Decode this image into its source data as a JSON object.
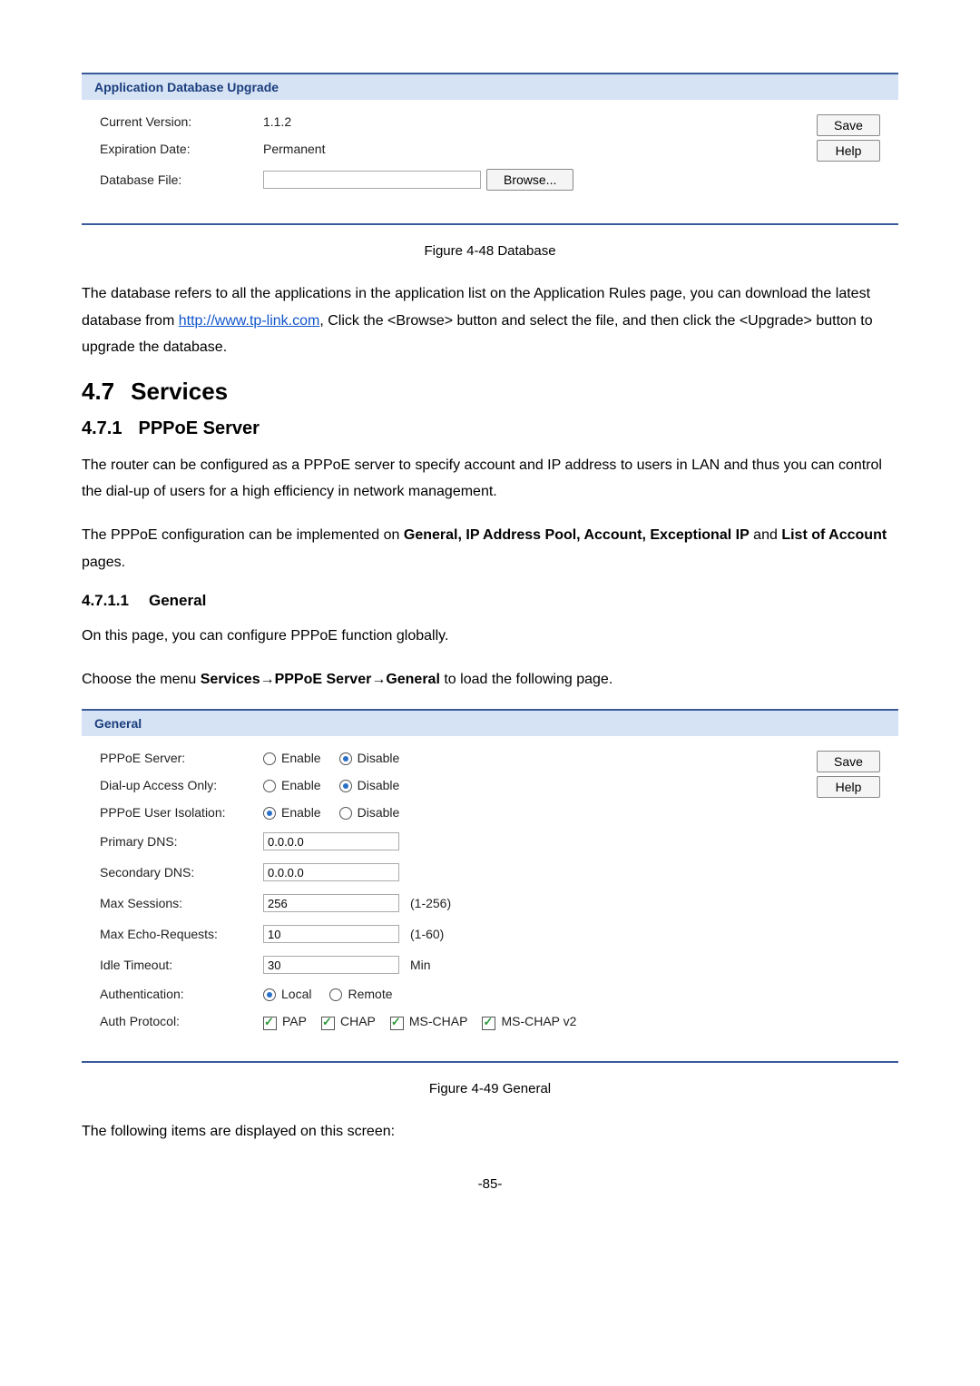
{
  "panel1": {
    "title": "Application Database Upgrade",
    "rows": {
      "current_version": {
        "label": "Current Version:",
        "value": "1.1.2"
      },
      "expiration_date": {
        "label": "Expiration Date:",
        "value": "Permanent"
      },
      "database_file": {
        "label": "Database File:"
      }
    },
    "browse_btn": "Browse...",
    "save_btn": "Save",
    "help_btn": "Help"
  },
  "figure48": "Figure 4-48 Database",
  "para1_a": "The database refers to all the applications in the application list on the Application Rules page, you can download the latest database from ",
  "para1_link": "http://www.tp-link.com",
  "para1_b": ", Click the <Browse> button and select the file, and then click the <Upgrade> button to upgrade the database.",
  "h_services": {
    "num": "4.7",
    "title": "Services"
  },
  "h_pppoe": {
    "num": "4.7.1",
    "title": "PPPoE Server"
  },
  "para2": "The router can be configured as a PPPoE server to specify account and IP address to users in LAN and thus you can control the dial-up of users for a high efficiency in network management.",
  "para3_a": "The PPPoE configuration can be implemented on ",
  "para3_bold": "General, IP Address Pool, Account, Exceptional IP",
  "para3_b": " and ",
  "para3_bold2": "List of Account",
  "para3_c": " pages.",
  "h_general": {
    "num": "4.7.1.1",
    "title": "General"
  },
  "para4": "On this page, you can configure PPPoE function globally.",
  "para5_a": "Choose the menu ",
  "para5_bold": "Services→PPPoE Server→General",
  "para5_b": " to load the following page.",
  "panel2": {
    "title": "General",
    "save_btn": "Save",
    "help_btn": "Help",
    "pppoe_server": {
      "label": "PPPoE Server:",
      "enable": "Enable",
      "disable": "Disable"
    },
    "dial_up": {
      "label": "Dial-up Access Only:",
      "enable": "Enable",
      "disable": "Disable"
    },
    "isolation": {
      "label": "PPPoE User Isolation:",
      "enable": "Enable",
      "disable": "Disable"
    },
    "primary_dns": {
      "label": "Primary DNS:",
      "value": "0.0.0.0"
    },
    "secondary_dns": {
      "label": "Secondary DNS:",
      "value": "0.0.0.0"
    },
    "max_sessions": {
      "label": "Max Sessions:",
      "value": "256",
      "hint": "(1-256)"
    },
    "max_echo": {
      "label": "Max Echo-Requests:",
      "value": "10",
      "hint": "(1-60)"
    },
    "idle_timeout": {
      "label": "Idle Timeout:",
      "value": "30",
      "hint": "Min"
    },
    "auth": {
      "label": "Authentication:",
      "local": "Local",
      "remote": "Remote"
    },
    "auth_proto": {
      "label": "Auth Protocol:",
      "pap": "PAP",
      "chap": "CHAP",
      "mschap": "MS-CHAP",
      "mschapv2": "MS-CHAP v2"
    }
  },
  "figure49": "Figure 4-49 General",
  "para6": "The following items are displayed on this screen:",
  "pagenum": "-85-"
}
